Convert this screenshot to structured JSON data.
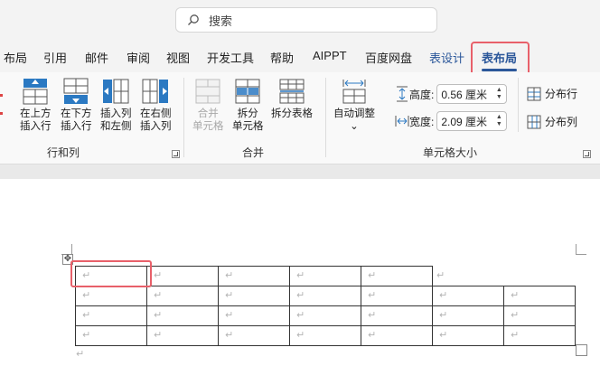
{
  "search": {
    "label": "搜索"
  },
  "tabs": [
    {
      "label": "布局"
    },
    {
      "label": "引用"
    },
    {
      "label": "邮件"
    },
    {
      "label": "审阅"
    },
    {
      "label": "视图"
    },
    {
      "label": "开发工具"
    },
    {
      "label": "帮助"
    },
    {
      "label": "AIPPT"
    },
    {
      "label": "百度网盘"
    },
    {
      "label": "表设计"
    },
    {
      "label": "表布局"
    }
  ],
  "ribbon": {
    "rows_cols": {
      "insert_above": [
        "在上方",
        "插入行"
      ],
      "insert_below": [
        "在下方",
        "插入行"
      ],
      "insert_left": [
        "插入列",
        "和左侧"
      ],
      "insert_right": [
        "在右侧",
        "插入列"
      ],
      "group_label": "行和列"
    },
    "merge": {
      "merge_cells": [
        "合并",
        "单元格"
      ],
      "split_cells": [
        "拆分",
        "单元格"
      ],
      "split_table": "拆分表格",
      "group_label": "合并"
    },
    "cell_size": {
      "autofit": "自动调整",
      "height_label": "高度:",
      "height_value": "0.56 厘米",
      "width_label": "宽度:",
      "width_value": "2.09 厘米",
      "distribute_rows": "分布行",
      "distribute_cols": "分布列",
      "group_label": "单元格大小"
    }
  },
  "document": {
    "paragraph_mark": "↵"
  },
  "colors": {
    "accent": "#2b579a",
    "highlight": "#e8606a",
    "icon_blue": "#2b79c2"
  }
}
